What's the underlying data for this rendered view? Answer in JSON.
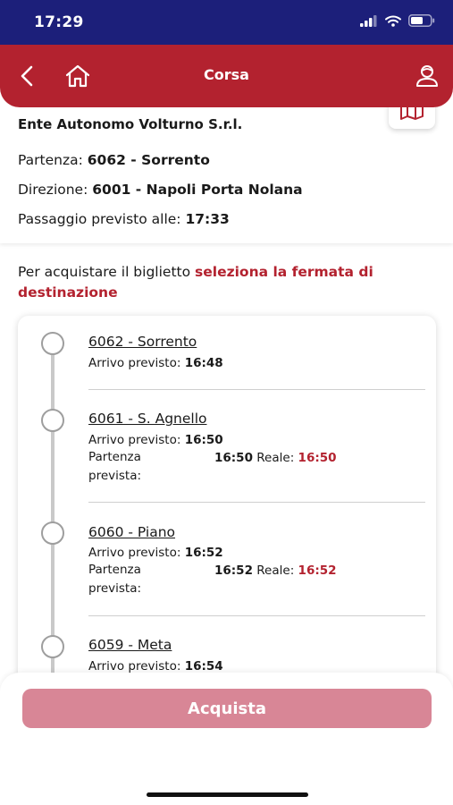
{
  "status_bar": {
    "time": "17:29"
  },
  "header": {
    "title": "Corsa",
    "icons": [
      "back-icon",
      "home-icon",
      "user-icon"
    ]
  },
  "info": {
    "company": "Ente Autonomo Volturno S.r.l.",
    "departure_label": "Partenza:",
    "departure_value": "6062 - Sorrento",
    "direction_label": "Direzione:",
    "direction_value": "6001 - Napoli Porta Nolana",
    "passage_label": "Passaggio previsto alle:",
    "passage_value": "17:33"
  },
  "instruction": {
    "text": "Per acquistare il biglietto ",
    "highlight": "seleziona la fermata di destinazione"
  },
  "stops": [
    {
      "name": "6062 - Sorrento",
      "arrival_label": "Arrivo previsto:",
      "arrival": "16:48"
    },
    {
      "name": "6061 - S. Agnello",
      "arrival_label": "Arrivo previsto:",
      "arrival": "16:50",
      "dep_label": "Partenza prevista:",
      "dep": "16:50",
      "real_label": "Reale:",
      "real": "16:50"
    },
    {
      "name": "6060 - Piano",
      "arrival_label": "Arrivo previsto:",
      "arrival": "16:52",
      "dep_label": "Partenza prevista:",
      "dep": "16:52",
      "real_label": "Reale:",
      "real": "16:52"
    },
    {
      "name": "6059 - Meta",
      "arrival_label": "Arrivo previsto:",
      "arrival": "16:54"
    }
  ],
  "buy_button": {
    "label": "Acquista"
  },
  "colors": {
    "primary": "#b3222f",
    "status_bar": "#1c1f7a",
    "button_disabled": "#d88696"
  }
}
